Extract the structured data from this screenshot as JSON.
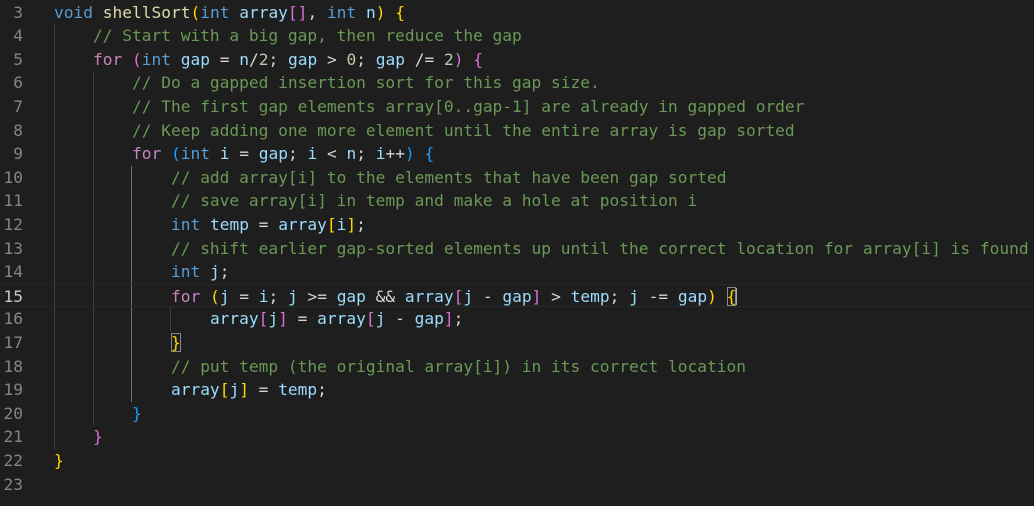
{
  "editor": {
    "language": "cpp",
    "current_line": 15,
    "lines": [
      {
        "number": "3",
        "tokens": [
          [
            "kw",
            "void"
          ],
          [
            "op",
            " "
          ],
          [
            "fn",
            "shellSort"
          ],
          [
            "b1",
            "("
          ],
          [
            "kw",
            "int"
          ],
          [
            "op",
            " "
          ],
          [
            "var",
            "array"
          ],
          [
            "b2",
            "[]"
          ],
          [
            "op",
            ", "
          ],
          [
            "kw",
            "int"
          ],
          [
            "op",
            " "
          ],
          [
            "var",
            "n"
          ],
          [
            "b1",
            ")"
          ],
          [
            "op",
            " "
          ],
          [
            "b1",
            "{"
          ]
        ]
      },
      {
        "number": "4",
        "tokens": [
          [
            "op",
            "    "
          ],
          [
            "cmt",
            "// Start with a big gap, then reduce the gap"
          ]
        ]
      },
      {
        "number": "5",
        "tokens": [
          [
            "op",
            "    "
          ],
          [
            "ctl",
            "for"
          ],
          [
            "op",
            " "
          ],
          [
            "b2",
            "("
          ],
          [
            "kw",
            "int"
          ],
          [
            "op",
            " "
          ],
          [
            "var",
            "gap"
          ],
          [
            "op",
            " = "
          ],
          [
            "var",
            "n"
          ],
          [
            "op",
            "/"
          ],
          [
            "num",
            "2"
          ],
          [
            "op",
            "; "
          ],
          [
            "var",
            "gap"
          ],
          [
            "op",
            " > "
          ],
          [
            "num",
            "0"
          ],
          [
            "op",
            "; "
          ],
          [
            "var",
            "gap"
          ],
          [
            "op",
            " /= "
          ],
          [
            "num",
            "2"
          ],
          [
            "b2",
            ")"
          ],
          [
            "op",
            " "
          ],
          [
            "b2",
            "{"
          ]
        ]
      },
      {
        "number": "6",
        "tokens": [
          [
            "op",
            "        "
          ],
          [
            "cmt",
            "// Do a gapped insertion sort for this gap size."
          ]
        ]
      },
      {
        "number": "7",
        "tokens": [
          [
            "op",
            "        "
          ],
          [
            "cmt",
            "// The first gap elements array[0..gap-1] are already in gapped order"
          ]
        ]
      },
      {
        "number": "8",
        "tokens": [
          [
            "op",
            "        "
          ],
          [
            "cmt",
            "// Keep adding one more element until the entire array is gap sorted"
          ]
        ]
      },
      {
        "number": "9",
        "tokens": [
          [
            "op",
            "        "
          ],
          [
            "ctl",
            "for"
          ],
          [
            "op",
            " "
          ],
          [
            "b3",
            "("
          ],
          [
            "kw",
            "int"
          ],
          [
            "op",
            " "
          ],
          [
            "var",
            "i"
          ],
          [
            "op",
            " = "
          ],
          [
            "var",
            "gap"
          ],
          [
            "op",
            "; "
          ],
          [
            "var",
            "i"
          ],
          [
            "op",
            " < "
          ],
          [
            "var",
            "n"
          ],
          [
            "op",
            "; "
          ],
          [
            "var",
            "i"
          ],
          [
            "op",
            "++"
          ],
          [
            "b3",
            ")"
          ],
          [
            "op",
            " "
          ],
          [
            "b3",
            "{"
          ]
        ]
      },
      {
        "number": "10",
        "tokens": [
          [
            "op",
            "            "
          ],
          [
            "cmt",
            "// add array[i] to the elements that have been gap sorted"
          ]
        ]
      },
      {
        "number": "11",
        "tokens": [
          [
            "op",
            "            "
          ],
          [
            "cmt",
            "// save array[i] in temp and make a hole at position i"
          ]
        ]
      },
      {
        "number": "12",
        "tokens": [
          [
            "op",
            "            "
          ],
          [
            "kw",
            "int"
          ],
          [
            "op",
            " "
          ],
          [
            "var",
            "temp"
          ],
          [
            "op",
            " = "
          ],
          [
            "var",
            "array"
          ],
          [
            "b1",
            "["
          ],
          [
            "var",
            "i"
          ],
          [
            "b1",
            "]"
          ],
          [
            "op",
            ";"
          ]
        ]
      },
      {
        "number": "13",
        "tokens": [
          [
            "op",
            "            "
          ],
          [
            "cmt",
            "// shift earlier gap-sorted elements up until the correct location for array[i] is found"
          ]
        ]
      },
      {
        "number": "14",
        "tokens": [
          [
            "op",
            "            "
          ],
          [
            "kw",
            "int"
          ],
          [
            "op",
            " "
          ],
          [
            "var",
            "j"
          ],
          [
            "op",
            ";"
          ]
        ]
      },
      {
        "number": "15",
        "tokens": [
          [
            "op",
            "            "
          ],
          [
            "ctl",
            "for"
          ],
          [
            "op",
            " "
          ],
          [
            "b1",
            "("
          ],
          [
            "var",
            "j"
          ],
          [
            "op",
            " = "
          ],
          [
            "var",
            "i"
          ],
          [
            "op",
            "; "
          ],
          [
            "var",
            "j"
          ],
          [
            "op",
            " >= "
          ],
          [
            "var",
            "gap"
          ],
          [
            "op",
            " && "
          ],
          [
            "var",
            "array"
          ],
          [
            "b2",
            "["
          ],
          [
            "var",
            "j"
          ],
          [
            "op",
            " - "
          ],
          [
            "var",
            "gap"
          ],
          [
            "b2",
            "]"
          ],
          [
            "op",
            " > "
          ],
          [
            "var",
            "temp"
          ],
          [
            "op",
            "; "
          ],
          [
            "var",
            "j"
          ],
          [
            "op",
            " -= "
          ],
          [
            "var",
            "gap"
          ],
          [
            "b1",
            ")"
          ],
          [
            "op",
            " "
          ],
          [
            "b1 bm",
            "{"
          ],
          [
            "cursor",
            ""
          ]
        ]
      },
      {
        "number": "16",
        "tokens": [
          [
            "op",
            "                "
          ],
          [
            "var",
            "array"
          ],
          [
            "b2",
            "["
          ],
          [
            "var",
            "j"
          ],
          [
            "b2",
            "]"
          ],
          [
            "op",
            " = "
          ],
          [
            "var",
            "array"
          ],
          [
            "b2",
            "["
          ],
          [
            "var",
            "j"
          ],
          [
            "op",
            " - "
          ],
          [
            "var",
            "gap"
          ],
          [
            "b2",
            "]"
          ],
          [
            "op",
            ";"
          ]
        ]
      },
      {
        "number": "17",
        "tokens": [
          [
            "op",
            "            "
          ],
          [
            "b1 bm",
            "}"
          ]
        ]
      },
      {
        "number": "18",
        "tokens": [
          [
            "op",
            "            "
          ],
          [
            "cmt",
            "// put temp (the original array[i]) in its correct location"
          ]
        ]
      },
      {
        "number": "19",
        "tokens": [
          [
            "op",
            "            "
          ],
          [
            "var",
            "array"
          ],
          [
            "b1",
            "["
          ],
          [
            "var",
            "j"
          ],
          [
            "b1",
            "]"
          ],
          [
            "op",
            " = "
          ],
          [
            "var",
            "temp"
          ],
          [
            "op",
            ";"
          ]
        ]
      },
      {
        "number": "20",
        "tokens": [
          [
            "op",
            "        "
          ],
          [
            "b3",
            "}"
          ]
        ]
      },
      {
        "number": "21",
        "tokens": [
          [
            "op",
            "    "
          ],
          [
            "b2",
            "}"
          ]
        ]
      },
      {
        "number": "22",
        "tokens": [
          [
            "b1",
            "}"
          ]
        ]
      },
      {
        "number": "23",
        "tokens": []
      }
    ]
  },
  "colors": {
    "background": "#1e1e1e",
    "keyword": "#569cd6",
    "control": "#c586c0",
    "function": "#dcdcaa",
    "variable": "#9cdcfe",
    "number": "#b5cea8",
    "comment": "#6a9955",
    "bracket1": "#ffd700",
    "bracket2": "#da70d6",
    "bracket3": "#179fff"
  }
}
